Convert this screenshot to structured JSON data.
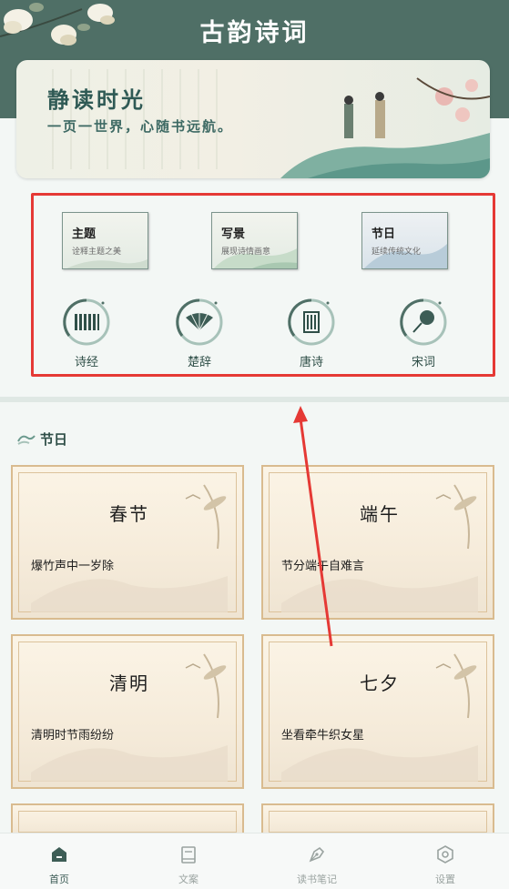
{
  "header": {
    "app_title": "古韵诗词",
    "banner_title": "静读时光",
    "banner_subtitle": "一页一世界，心随书远航。"
  },
  "categories": {
    "cards": [
      {
        "title": "主题",
        "subtitle": "诠释主题之美"
      },
      {
        "title": "写景",
        "subtitle": "展现诗情画意"
      },
      {
        "title": "节日",
        "subtitle": "延续传统文化"
      }
    ],
    "circles": [
      {
        "label": "诗经",
        "icon": "bamboo-scroll-icon"
      },
      {
        "label": "楚辞",
        "icon": "folding-fan-icon"
      },
      {
        "label": "唐诗",
        "icon": "book-scroll-icon"
      },
      {
        "label": "宋词",
        "icon": "round-fan-icon"
      }
    ]
  },
  "section": {
    "title": "节日",
    "icon": "cloud-swirl-icon"
  },
  "festivals": [
    {
      "title": "春节",
      "line": "爆竹声中一岁除"
    },
    {
      "title": "端午",
      "line": "节分端午自难言"
    },
    {
      "title": "清明",
      "line": "清明时节雨纷纷"
    },
    {
      "title": "七夕",
      "line": "坐看牵牛织女星"
    }
  ],
  "bottom_nav": {
    "items": [
      {
        "label": "首页",
        "icon": "home-icon"
      },
      {
        "label": "文案",
        "icon": "book-icon"
      },
      {
        "label": "读书笔记",
        "icon": "pen-nib-icon"
      },
      {
        "label": "设置",
        "icon": "settings-hexagon-icon"
      }
    ]
  },
  "colors": {
    "header_bg": "#4f6f66",
    "accent": "#3d5d56",
    "highlight_border": "#e53935",
    "card_border": "#d9bb8f"
  }
}
